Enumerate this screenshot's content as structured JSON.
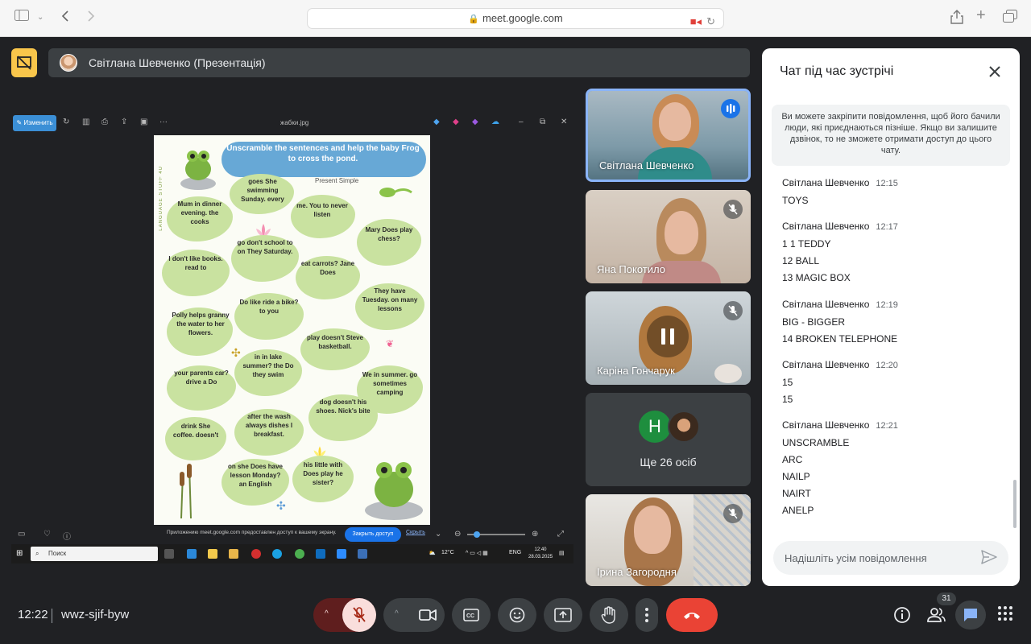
{
  "browser": {
    "url": "meet.google.com"
  },
  "presentation": {
    "title": "Світлана Шевченко (Презентація)"
  },
  "shared_screen": {
    "toolbar": {
      "edit_label": "Изменить",
      "file_name": "жабки.jpg"
    },
    "worksheet": {
      "side_label": "LANGUAGE STUFF 4U",
      "title": "Unscramble the sentences and help the baby Frog to cross the pond.",
      "subtitle": "Present Simple",
      "pads": [
        "goes She swimming Sunday. every",
        "Mum in dinner evening. the cooks",
        "me. You to never listen",
        "Mary Does play chess?",
        "go don't school to on They Saturday.",
        "I don't like books. read to",
        "eat carrots? Jane Does",
        "They have Tuesday. on many lessons",
        "Do like ride a bike? to you",
        "Polly helps granny the water to her flowers.",
        "play doesn't Steve basketball.",
        "in in lake summer? the Do they swim",
        "your parents car? drive a Do",
        "We in summer. go sometimes camping",
        "after the wash always dishes I breakfast.",
        "dog doesn't his shoes. Nick's bite",
        "drink She coffee. doesn't",
        "on she Does have lesson Monday? an English",
        "his little with Does play he sister?"
      ]
    },
    "share_notice": "Приложению meet.google.com предоставлен доступ к вашему экрану.",
    "stop_sharing_label": "Закрыть доступ",
    "hide_label": "Скрыть",
    "taskbar": {
      "search_placeholder": "Поиск",
      "weather": "12°C",
      "lang": "ENG",
      "time": "12:40",
      "date": "28.03.2025"
    }
  },
  "participants": [
    {
      "name": "Світлана Шевченко",
      "state": "speaking"
    },
    {
      "name": "Яна Покотило",
      "state": "muted"
    },
    {
      "name": "Каріна Гончарук",
      "state": "muted-paused"
    },
    {
      "name": "Ірина Загородня",
      "state": "muted"
    }
  ],
  "others_tile": {
    "avatar_letter": "Н",
    "label": "Ще 26 осіб"
  },
  "chat": {
    "title": "Чат під час зустрічі",
    "pin_note": "Ви можете закріпити повідомлення, щоб його бачили люди, які приєднаються пізніше. Якщо ви залишите дзвінок, то не зможете отримати доступ до цього чату.",
    "messages": [
      {
        "sender": "Світлана Шевченко",
        "time": "12:15",
        "lines": [
          "TOYS"
        ]
      },
      {
        "sender": "Світлана Шевченко",
        "time": "12:17",
        "lines": [
          "1 1 TEDDY",
          "12 BALL",
          "13 MAGIC BOX"
        ]
      },
      {
        "sender": "Світлана Шевченко",
        "time": "12:19",
        "lines": [
          "BIG - BIGGER",
          "14 BROKEN TELEPHONE"
        ]
      },
      {
        "sender": "Світлана Шевченко",
        "time": "12:20",
        "lines": [
          "15",
          "15"
        ]
      },
      {
        "sender": "Світлана Шевченко",
        "time": "12:21",
        "lines": [
          "UNSCRAMBLE",
          "ARC",
          "NAILP",
          "NAIRT",
          "ANELP"
        ]
      }
    ],
    "input_placeholder": "Надішліть усім повідомлення"
  },
  "bottom_bar": {
    "time": "12:22",
    "meeting_code": "wwz-sjif-byw",
    "people_count": "31"
  },
  "colors": {
    "meet_bg": "#202124",
    "control_bg": "#3c4043",
    "end_call": "#ea4335",
    "active_tile_border": "#8ab4f8",
    "presentation_badge": "#f9c64b"
  }
}
